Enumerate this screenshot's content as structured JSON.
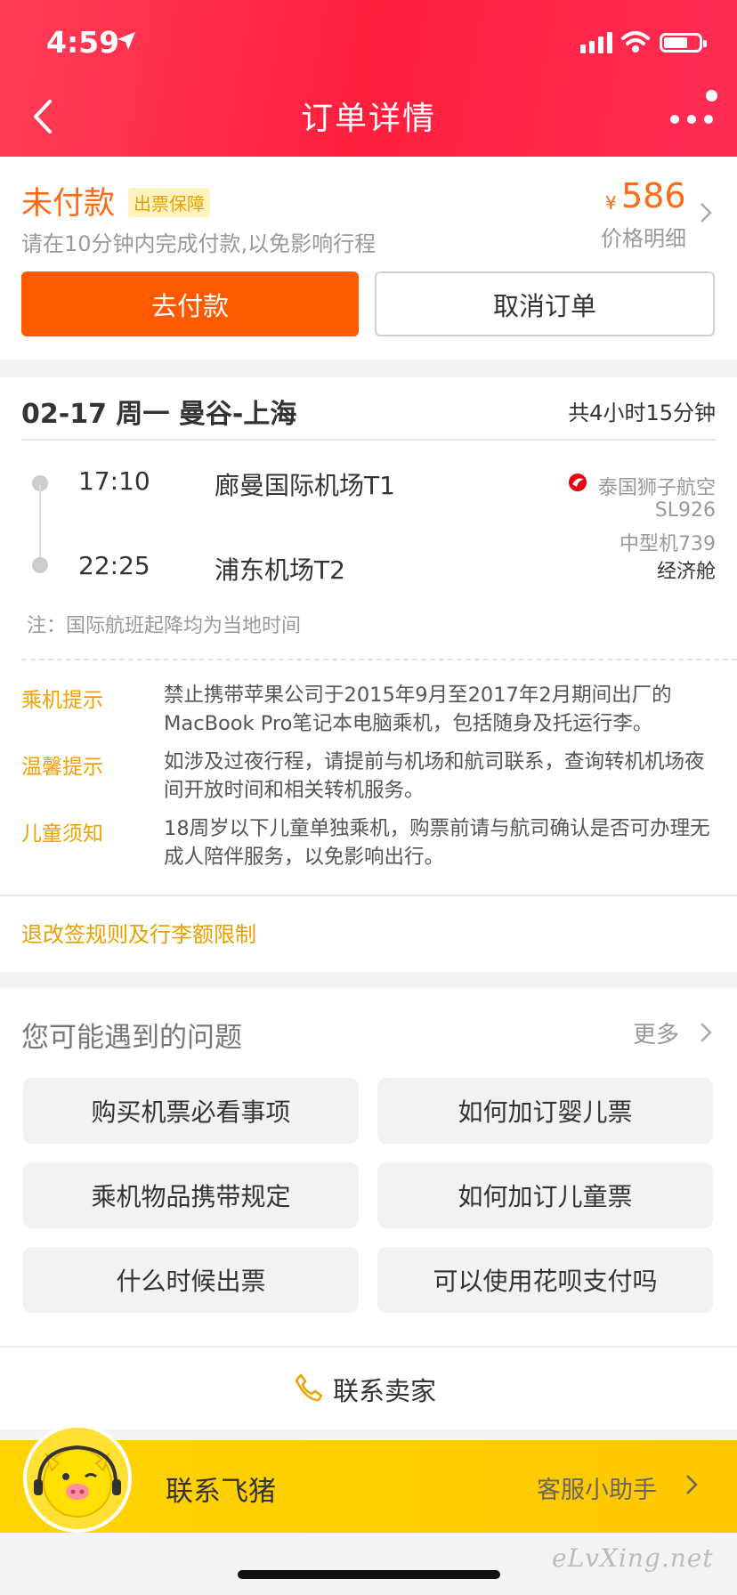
{
  "status_bar": {
    "time": "4:59"
  },
  "header": {
    "title": "订单详情"
  },
  "payment": {
    "status": "未付款",
    "badge": "出票保障",
    "hint": "请在10分钟内完成付款,以免影响行程",
    "currency": "¥",
    "price": "586",
    "price_detail": "价格明细",
    "pay_button": "去付款",
    "cancel_button": "取消订单"
  },
  "flight": {
    "route": "02-17 周一 曼谷-上海",
    "duration": "共4小时15分钟",
    "depart_time": "17:10",
    "depart_airport": "廊曼国际机场T1",
    "arrive_time": "22:25",
    "arrive_airport": "浦东机场T2",
    "airline": "泰国狮子航空",
    "flight_no": "SL926",
    "aircraft": "中型机739",
    "cabin": "经济舱",
    "note": "注：国际航班起降均为当地时间"
  },
  "tips": [
    {
      "label": "乘机提示",
      "text": "禁止携带苹果公司于2015年9月至2017年2月期间出厂的MacBook Pro笔记本电脑乘机，包括随身及托运行李。"
    },
    {
      "label": "温馨提示",
      "text": "如涉及过夜行程，请提前与机场和航司联系，查询转机机场夜间开放时间和相关转机服务。"
    },
    {
      "label": "儿童须知",
      "text": "18周岁以下儿童单独乘机，购票前请与航司确认是否可办理无成人陪伴服务，以免影响出行。"
    }
  ],
  "rules_link": "退改签规则及行李额限制",
  "faq": {
    "title": "您可能遇到的问题",
    "more": "更多",
    "items": [
      "购买机票必看事项",
      "如何加订婴儿票",
      "乘机物品携带规定",
      "如何加订儿童票",
      "什么时候出票",
      "可以使用花呗支付吗"
    ]
  },
  "contact_seller": "联系卖家",
  "fliggy": {
    "label": "联系飞猪",
    "assistant": "客服小助手"
  },
  "watermark": "eLvXing.net",
  "colors": {
    "header": "#ff1f3d",
    "accent": "#ff5a00",
    "tip": "#f0a000",
    "fliggy": "#ffd400"
  }
}
